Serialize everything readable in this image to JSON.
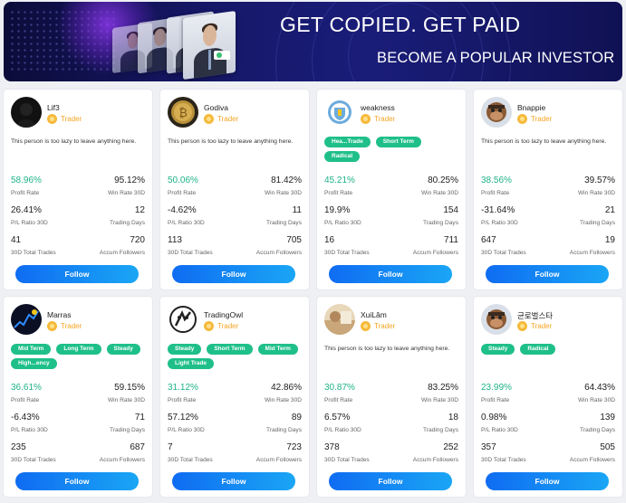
{
  "banner": {
    "title": "GET COPIED. GET  PAID",
    "subtitle": "BECOME A POPULAR INVESTOR"
  },
  "labels": {
    "profit_rate": "Profit Rate",
    "win_rate": "Win Rate 30D",
    "pl_ratio": "P/L Ratio 30D",
    "trading_days": "Trading Days",
    "total_trades": "30D Total Trades",
    "followers": "Accum Followers",
    "follow": "Follow",
    "role": "Trader"
  },
  "colors": {
    "accent": "#0f6cf2",
    "positive": "#1fb388",
    "tag": "#1fbf8a",
    "role": "#f5a524"
  },
  "traders": [
    {
      "name": "Lif3",
      "avatar": "dark-black-avatar",
      "bio": "This person is too lazy to leave anything here.",
      "tags": [],
      "profit_rate": "58.96%",
      "win_rate": "95.12%",
      "pl_ratio": "26.41%",
      "trading_days": "12",
      "total_trades": "41",
      "followers": "720"
    },
    {
      "name": "Godiva",
      "avatar": "bitcoin-coin-avatar",
      "bio": "This person is too lazy to leave anything here.",
      "tags": [],
      "profit_rate": "50.06%",
      "win_rate": "81.42%",
      "pl_ratio": "-4.62%",
      "trading_days": "11",
      "total_trades": "113",
      "followers": "705"
    },
    {
      "name": "weakness",
      "avatar": "club-crest-avatar",
      "bio": "",
      "tags": [
        "Hea...Trade",
        "Short Term",
        "Radical"
      ],
      "profit_rate": "45.21%",
      "win_rate": "80.25%",
      "pl_ratio": "19.9%",
      "trading_days": "154",
      "total_trades": "16",
      "followers": "711"
    },
    {
      "name": "Bnappie",
      "avatar": "ape-avatar",
      "bio": "This person is too lazy to leave anything here.",
      "tags": [],
      "profit_rate": "38.56%",
      "win_rate": "39.57%",
      "pl_ratio": "-31.64%",
      "trading_days": "21",
      "total_trades": "647",
      "followers": "19"
    },
    {
      "name": "Marras",
      "avatar": "chart-night-avatar",
      "bio": "",
      "tags": [
        "Mid Term",
        "Long Term",
        "Steady",
        "High...ency"
      ],
      "profit_rate": "36.61%",
      "win_rate": "59.15%",
      "pl_ratio": "-6.43%",
      "trading_days": "71",
      "total_trades": "235",
      "followers": "687"
    },
    {
      "name": "TradingOwl",
      "avatar": "owl-logo-avatar",
      "bio": "",
      "tags": [
        "Steady",
        "Short Term",
        "Mid Term",
        "Light Trade"
      ],
      "profit_rate": "31.12%",
      "win_rate": "42.86%",
      "pl_ratio": "57.12%",
      "trading_days": "89",
      "total_trades": "7",
      "followers": "723"
    },
    {
      "name": "XuiLâm",
      "avatar": "photo-avatar",
      "bio": "This person is too lazy to leave anything here.",
      "tags": [],
      "profit_rate": "30.87%",
      "win_rate": "83.25%",
      "pl_ratio": "6.57%",
      "trading_days": "18",
      "total_trades": "378",
      "followers": "252"
    },
    {
      "name": "균로벌스타",
      "avatar": "ape-avatar",
      "bio": "",
      "tags": [
        "Steady",
        "Radical"
      ],
      "profit_rate": "23.99%",
      "win_rate": "64.43%",
      "pl_ratio": "0.98%",
      "trading_days": "139",
      "total_trades": "357",
      "followers": "505"
    }
  ]
}
